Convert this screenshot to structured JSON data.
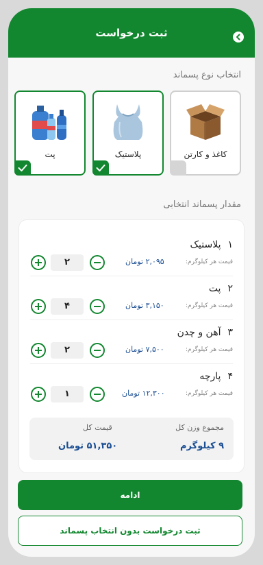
{
  "header": {
    "title": "ثبت درخواست"
  },
  "type_section": {
    "label": "انتخاب نوع پسماند",
    "cards": [
      {
        "label": "کاغذ و کارتن",
        "selected": false
      },
      {
        "label": "پلاستیک",
        "selected": true
      },
      {
        "label": "پت",
        "selected": true
      }
    ]
  },
  "amount_section": {
    "label": "مقدار پسماند انتخابی",
    "price_label": "قیمت هر کیلوگرم:",
    "items": [
      {
        "num": "۱",
        "name": "پلاستیک",
        "price": "۲,۰۹۵ تومان",
        "qty": "۲"
      },
      {
        "num": "۲",
        "name": "پت",
        "price": "۳,۱۵۰ تومان",
        "qty": "۴"
      },
      {
        "num": "۳",
        "name": "آهن و چدن",
        "price": "۷,۵۰۰ تومان",
        "qty": "۲"
      },
      {
        "num": "۴",
        "name": "پارچه",
        "price": "۱۲,۳۰۰ تومان",
        "qty": "۱"
      }
    ],
    "summary": {
      "weight_label": "مجموع وزن کل",
      "weight_value": "۹ کیلوگرم",
      "total_label": "قیمت کل",
      "total_value": "۵۱,۳۵۰ تومان"
    }
  },
  "actions": {
    "continue_label": "ادامه",
    "submit_without_label": "ثبت درخواست بدون انتخاب پسماند"
  }
}
